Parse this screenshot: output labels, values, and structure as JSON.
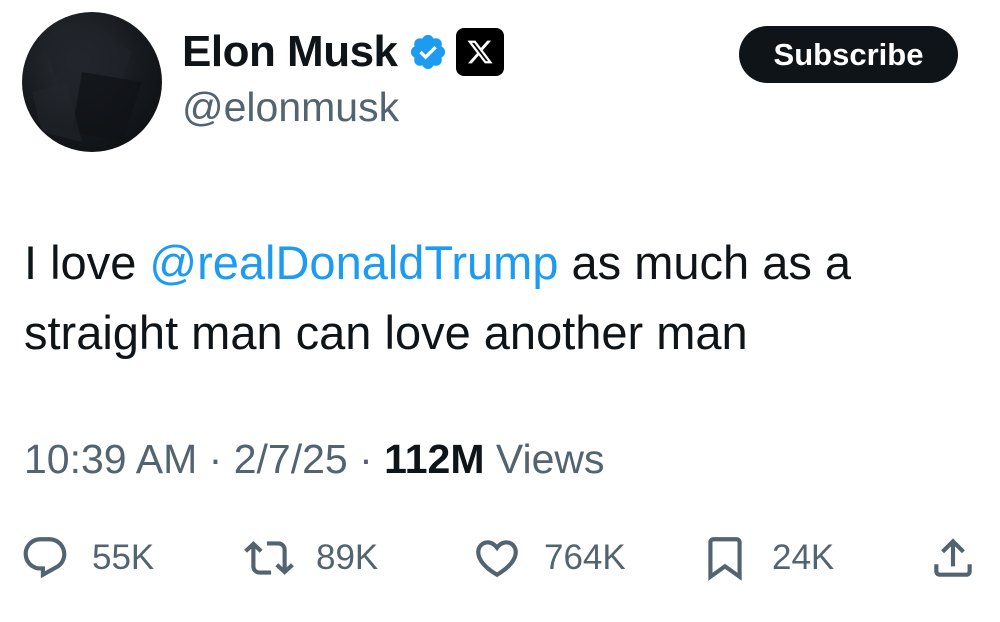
{
  "author": {
    "display_name": "Elon Musk",
    "handle": "@elonmusk",
    "verified_color": "#1d9bf0"
  },
  "header": {
    "subscribe_label": "Subscribe"
  },
  "tweet": {
    "text_before": "I love ",
    "mention": "@realDonaldTrump",
    "text_after": " as much as a straight man can love another man"
  },
  "meta": {
    "time": "10:39 AM",
    "separator": "·",
    "date": "2/7/25",
    "views_count": "112M",
    "views_label": "Views"
  },
  "actions": {
    "replies": "55K",
    "reposts": "89K",
    "likes": "764K",
    "bookmarks": "24K"
  },
  "icons": {
    "verified": "verified-badge-icon",
    "affiliate": "x-logo-icon",
    "reply": "speech-bubble-icon",
    "repost": "repost-arrows-icon",
    "like": "heart-icon",
    "bookmark": "bookmark-icon",
    "share": "share-upload-icon"
  },
  "colors": {
    "text": "#0f1419",
    "secondary": "#536471",
    "link": "#1d9bf0",
    "button_bg": "#0f1419"
  }
}
